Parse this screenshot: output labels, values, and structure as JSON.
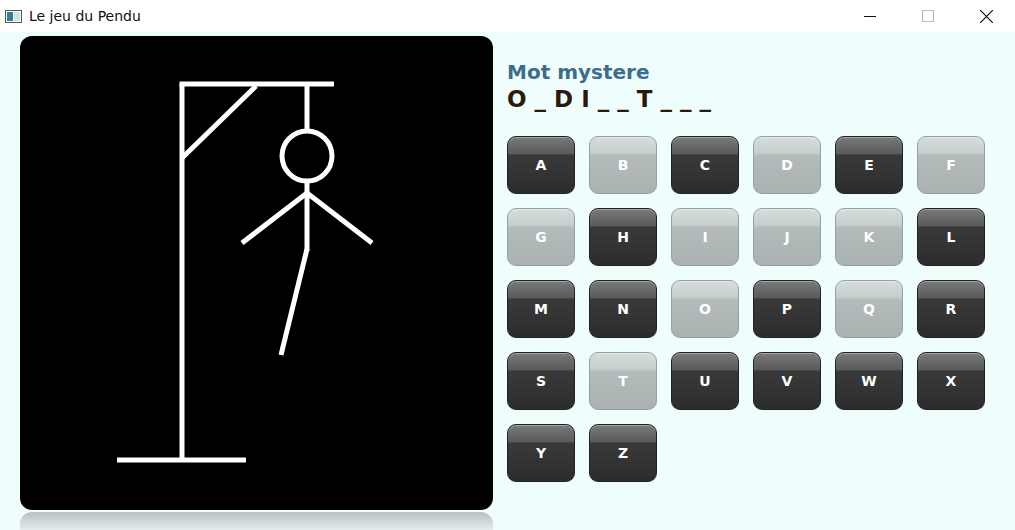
{
  "window": {
    "title": "Le jeu du Pendu"
  },
  "hangman": {
    "parts": [
      {
        "kind": "rope",
        "shown": true
      },
      {
        "kind": "head",
        "shown": true
      },
      {
        "kind": "body",
        "shown": true
      },
      {
        "kind": "left-arm",
        "shown": true
      },
      {
        "kind": "right-arm",
        "shown": true
      },
      {
        "kind": "left-leg",
        "shown": true
      },
      {
        "kind": "right-leg",
        "shown": false
      }
    ]
  },
  "mystery": {
    "title": "Mot mystere",
    "word": "O _ D I _ _ T _ _ _"
  },
  "letters": [
    {
      "label": "A",
      "used": false
    },
    {
      "label": "B",
      "used": true
    },
    {
      "label": "C",
      "used": false
    },
    {
      "label": "D",
      "used": true
    },
    {
      "label": "E",
      "used": false
    },
    {
      "label": "F",
      "used": true
    },
    {
      "label": "G",
      "used": true
    },
    {
      "label": "H",
      "used": false
    },
    {
      "label": "I",
      "used": true
    },
    {
      "label": "J",
      "used": true
    },
    {
      "label": "K",
      "used": true
    },
    {
      "label": "L",
      "used": false
    },
    {
      "label": "M",
      "used": false
    },
    {
      "label": "N",
      "used": false
    },
    {
      "label": "O",
      "used": true
    },
    {
      "label": "P",
      "used": false
    },
    {
      "label": "Q",
      "used": true
    },
    {
      "label": "R",
      "used": false
    },
    {
      "label": "S",
      "used": false
    },
    {
      "label": "T",
      "used": true
    },
    {
      "label": "U",
      "used": false
    },
    {
      "label": "V",
      "used": false
    },
    {
      "label": "W",
      "used": false
    },
    {
      "label": "X",
      "used": false
    },
    {
      "label": "Y",
      "used": false
    },
    {
      "label": "Z",
      "used": false
    }
  ]
}
